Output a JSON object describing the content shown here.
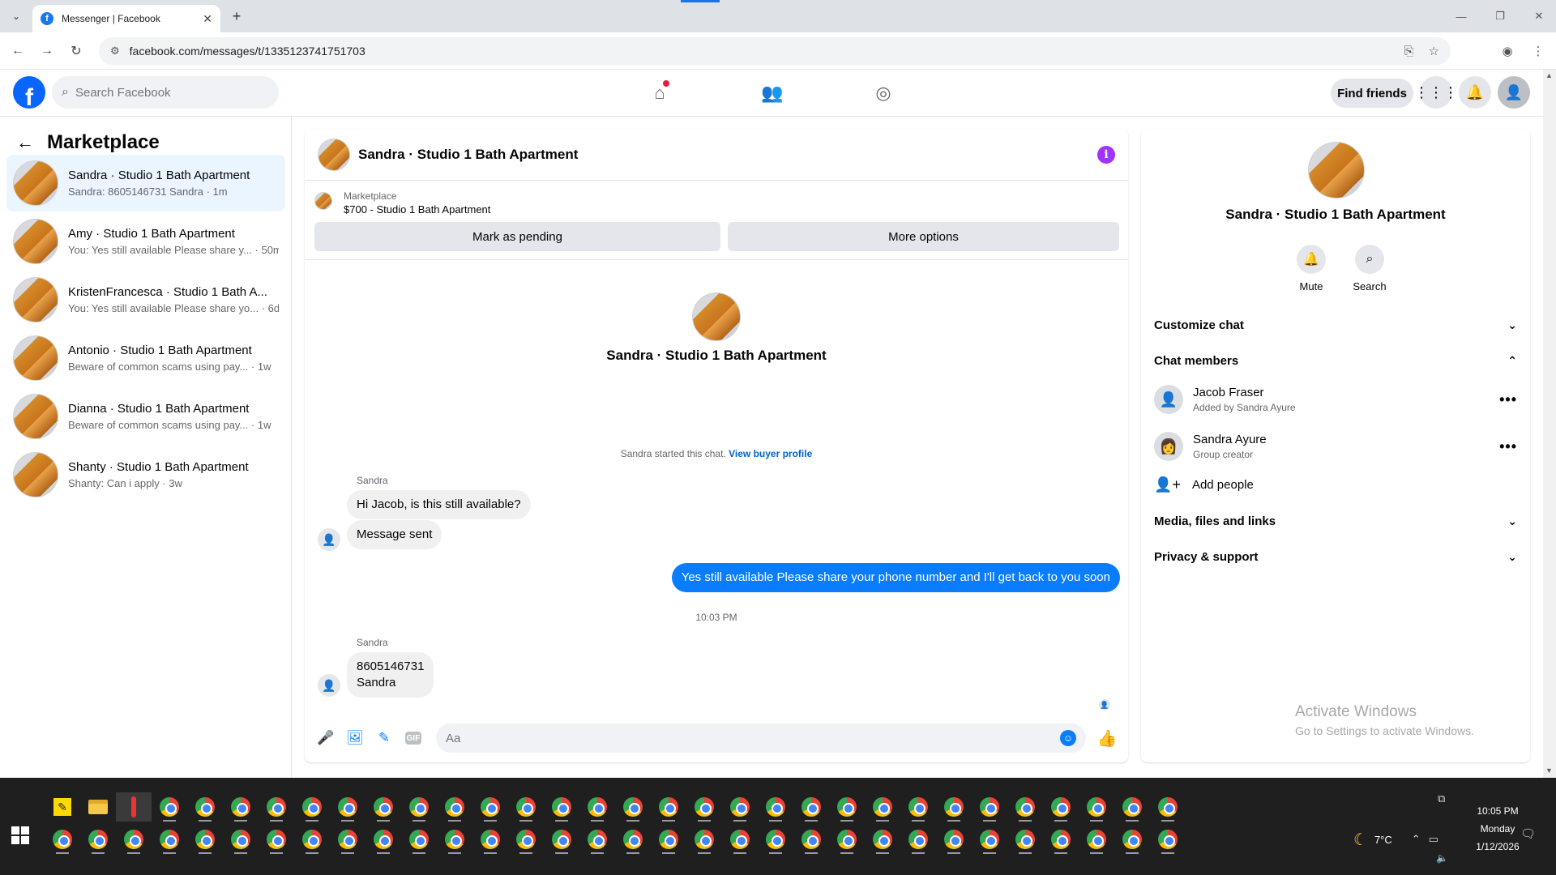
{
  "browser": {
    "tab_title": "Messenger | Facebook",
    "tab_close": "✕",
    "new_tab": "+",
    "url": "facebook.com/messages/t/1335123741751703"
  },
  "fb": {
    "search_placeholder": "Search Facebook",
    "find_friends": "Find friends",
    "logo_letter": "f"
  },
  "sidebar": {
    "title": "Marketplace",
    "conversations": [
      {
        "name": "Sandra · Studio 1 Bath Apartment",
        "preview": "Sandra: 8605146731 Sandra · 1m"
      },
      {
        "name": "Amy · Studio 1 Bath Apartment",
        "preview": "You: Yes still available Please share y... · 50m"
      },
      {
        "name": "KristenFrancesca · Studio 1 Bath A...",
        "preview": "You: Yes still available Please share yo... · 6d"
      },
      {
        "name": "Antonio · Studio 1 Bath Apartment",
        "preview": "Beware of common scams using pay... · 1w"
      },
      {
        "name": "Dianna · Studio 1 Bath Apartment",
        "preview": "Beware of common scams using pay... · 1w"
      },
      {
        "name": "Shanty · Studio 1 Bath Apartment",
        "preview": "Shanty: Can i apply · 3w"
      }
    ]
  },
  "chat": {
    "title": "Sandra · Studio 1 Bath Apartment",
    "marketplace_label": "Marketplace",
    "listing": "$700 - Studio 1 Bath Apartment",
    "mark_pending": "Mark as pending",
    "more_options": "More options",
    "intro_name": "Sandra · Studio 1 Bath Apartment",
    "started_text": "Sandra started this chat.",
    "view_profile": "View buyer profile",
    "messages": {
      "sender1": "Sandra",
      "msg1": "Hi Jacob, is this still available?",
      "msg2": "Message sent",
      "out1": "Yes still available Please share your phone number and I'll get back to you soon",
      "time": "10:03 PM",
      "sender2": "Sandra",
      "msg3_line1": "8605146731",
      "msg3_line2": "Sandra"
    },
    "composer_placeholder": "Aa",
    "gif_label": "GIF"
  },
  "details": {
    "title": "Sandra · Studio 1 Bath Apartment",
    "mute": "Mute",
    "search": "Search",
    "customize_chat": "Customize chat",
    "chat_members": "Chat members",
    "members": [
      {
        "name": "Jacob Fraser",
        "role": "Added by Sandra Ayure"
      },
      {
        "name": "Sandra Ayure",
        "role": "Group creator"
      }
    ],
    "add_people": "Add people",
    "media": "Media, files and links",
    "privacy": "Privacy & support"
  },
  "windows": {
    "activate_title": "Activate Windows",
    "activate_sub": "Go to Settings to activate Windows.",
    "temp": "7°C",
    "time": "10:05 PM",
    "day": "Monday",
    "date": "1/12/2026"
  },
  "colors": {
    "fb_blue": "#0866ff",
    "outgoing_bubble": "#0a7cff",
    "active_conv": "#ebf5ff",
    "info_purple": "#a033ff",
    "taskbar": "#1f1f1f"
  }
}
